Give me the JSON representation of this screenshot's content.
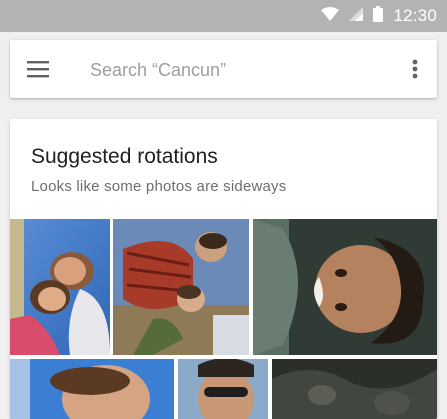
{
  "status_bar": {
    "time": "12:30",
    "icons": [
      "wifi-icon",
      "signal-icon",
      "battery-icon"
    ]
  },
  "search": {
    "placeholder": "Search “Cancun”",
    "value": ""
  },
  "card": {
    "title": "Suggested rotations",
    "subtitle": "Looks like some photos are sideways"
  },
  "colors": {
    "status_bar": "#b3b3b3",
    "background": "#efefef",
    "card": "#ffffff"
  }
}
